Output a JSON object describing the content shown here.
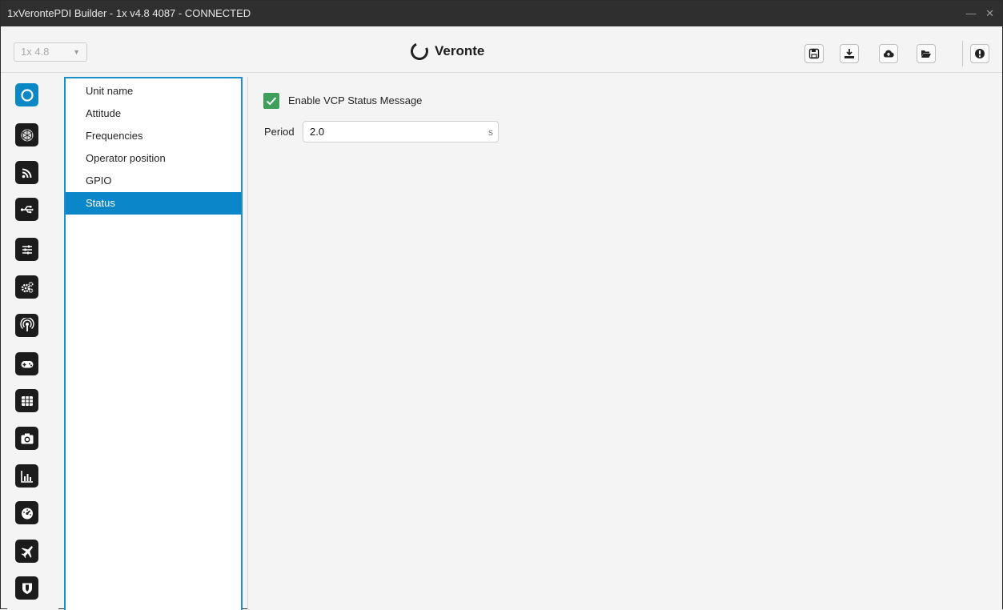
{
  "window": {
    "title": "1xVerontePDI Builder - 1x v4.8 4087 - CONNECTED",
    "controls": "— ✕"
  },
  "toolbar": {
    "version_value": "1x 4.8",
    "version_caret": "▼",
    "brand_name": "Veronte",
    "buttons": [
      "save-icon",
      "download-icon",
      "cloud-upload-icon",
      "folder-open-icon",
      "info-icon"
    ]
  },
  "sidebar": {
    "icons": [
      "veronte-ring-icon",
      "hexagon-network-icon",
      "wifi-signal-icon",
      "usb-icon",
      "sliders-icon",
      "gears-icon",
      "antenna-icon",
      "gamepad-icon",
      "grid-icon",
      "camera-icon",
      "bar-chart-icon",
      "gauge-icon",
      "airplane-icon",
      "shield-icon"
    ],
    "active": 0
  },
  "tree": {
    "items": [
      "Unit name",
      "Attitude",
      "Frequencies",
      "Operator position",
      "GPIO",
      "Status"
    ],
    "selected": 5
  },
  "form": {
    "checkbox_checked": true,
    "checkbox_label": "Enable VCP Status Message",
    "period_label": "Period",
    "period_value": "2.0",
    "period_unit": "s"
  },
  "colors": {
    "accent": "#0b86c8",
    "check_green": "#3d9f59",
    "titlebar": "#2f2f2f",
    "sidebar_button": "#1c1c1c"
  }
}
